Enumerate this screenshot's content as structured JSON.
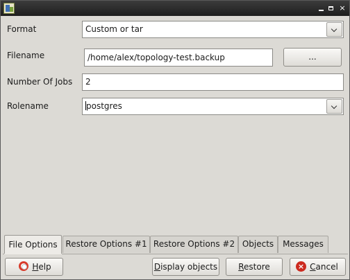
{
  "window": {
    "title": "",
    "buttons": {
      "minimize": "minimize",
      "maximize": "maximize",
      "close": "×"
    }
  },
  "form": {
    "format": {
      "label": "Format",
      "value": "Custom or tar"
    },
    "filename": {
      "label": "Filename",
      "value": "/home/alex/topology-test.backup",
      "browse_label": "..."
    },
    "jobs": {
      "label": "Number Of Jobs",
      "value": "2"
    },
    "rolename": {
      "label": "Rolename",
      "value": "postgres"
    }
  },
  "tabs": [
    {
      "label": "File Options",
      "active": true
    },
    {
      "label": "Restore Options #1",
      "active": false
    },
    {
      "label": "Restore Options #2",
      "active": false
    },
    {
      "label": "Objects",
      "active": false
    },
    {
      "label": "Messages",
      "active": false
    }
  ],
  "buttons": {
    "help": {
      "mnemonic": "H",
      "rest": "elp"
    },
    "display_objects": {
      "mnemonic": "D",
      "rest": "isplay objects"
    },
    "restore": {
      "mnemonic": "R",
      "rest": "estore"
    },
    "cancel": {
      "mnemonic": "C",
      "rest": "ancel"
    }
  },
  "colors": {
    "window_bg": "#dcdad5",
    "titlebar": "#1e1e1e",
    "cancel_icon": "#cc2a1f"
  },
  "icons": {
    "app": "pgadmin-app-icon",
    "help": "lifebuoy-icon",
    "cancel": "cancel-icon"
  }
}
